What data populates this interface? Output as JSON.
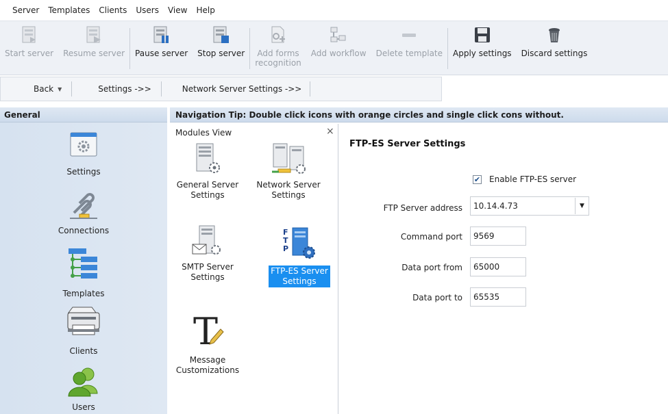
{
  "menu": [
    "Server",
    "Templates",
    "Clients",
    "Users",
    "View",
    "Help"
  ],
  "toolbar": {
    "buttons": [
      {
        "label": "Start server",
        "icon": "start-server-icon",
        "enabled": false
      },
      {
        "label": "Resume server",
        "icon": "resume-server-icon",
        "enabled": false
      },
      {
        "label": "Pause server",
        "icon": "pause-server-icon",
        "enabled": true
      },
      {
        "label": "Stop server",
        "icon": "stop-server-icon",
        "enabled": true
      },
      {
        "label": "Add forms recognition",
        "label_line1": "Add forms",
        "label_line2": "recognition",
        "icon": "add-forms-icon",
        "enabled": false
      },
      {
        "label": "Add workflow",
        "icon": "add-workflow-icon",
        "enabled": false
      },
      {
        "label": "Delete template",
        "icon": "delete-template-icon",
        "enabled": false
      },
      {
        "label": "Apply settings",
        "icon": "save-icon",
        "enabled": true
      },
      {
        "label": "Discard settings",
        "icon": "trash-icon",
        "enabled": true
      }
    ]
  },
  "breadcrumb": {
    "back": "Back",
    "settings": "Settings ->>",
    "network": "Network Server Settings ->>"
  },
  "left_panel": {
    "title": "General",
    "items": [
      {
        "label": "Settings",
        "icon": "settings-icon"
      },
      {
        "label": "Connections",
        "icon": "connections-icon"
      },
      {
        "label": "Templates",
        "icon": "templates-icon"
      },
      {
        "label": "Clients",
        "icon": "printer-icon"
      },
      {
        "label": "Users",
        "icon": "users-icon"
      }
    ]
  },
  "tip": "Navigation Tip: Double click icons with orange circles and single click cons without.",
  "modules_view": {
    "title": "Modules View",
    "close": "×",
    "modules": [
      {
        "label1": "General Server",
        "label2": "Settings",
        "selected": false
      },
      {
        "label1": "Network Server",
        "label2": "Settings",
        "selected": false
      },
      {
        "label1": "SMTP Server",
        "label2": "Settings",
        "selected": false
      },
      {
        "label1": "FTP-ES Server",
        "label2": "Settings",
        "selected": true
      },
      {
        "label1": "Message",
        "label2": "Customizations",
        "selected": false
      }
    ]
  },
  "settings": {
    "title": "FTP-ES Server Settings",
    "enable_label": "Enable FTP-ES server",
    "enable_checked": true,
    "address_label": "FTP Server address",
    "address_value": "10.14.4.73",
    "command_port_label": "Command port",
    "command_port_value": "9569",
    "data_from_label": "Data port from",
    "data_from_value": "65000",
    "data_to_label": "Data port to",
    "data_to_value": "65535"
  },
  "colors": {
    "selection": "#1a8ff0",
    "panel_blue": "#d6e2f0",
    "toolbar_bg": "#eef1f6"
  }
}
